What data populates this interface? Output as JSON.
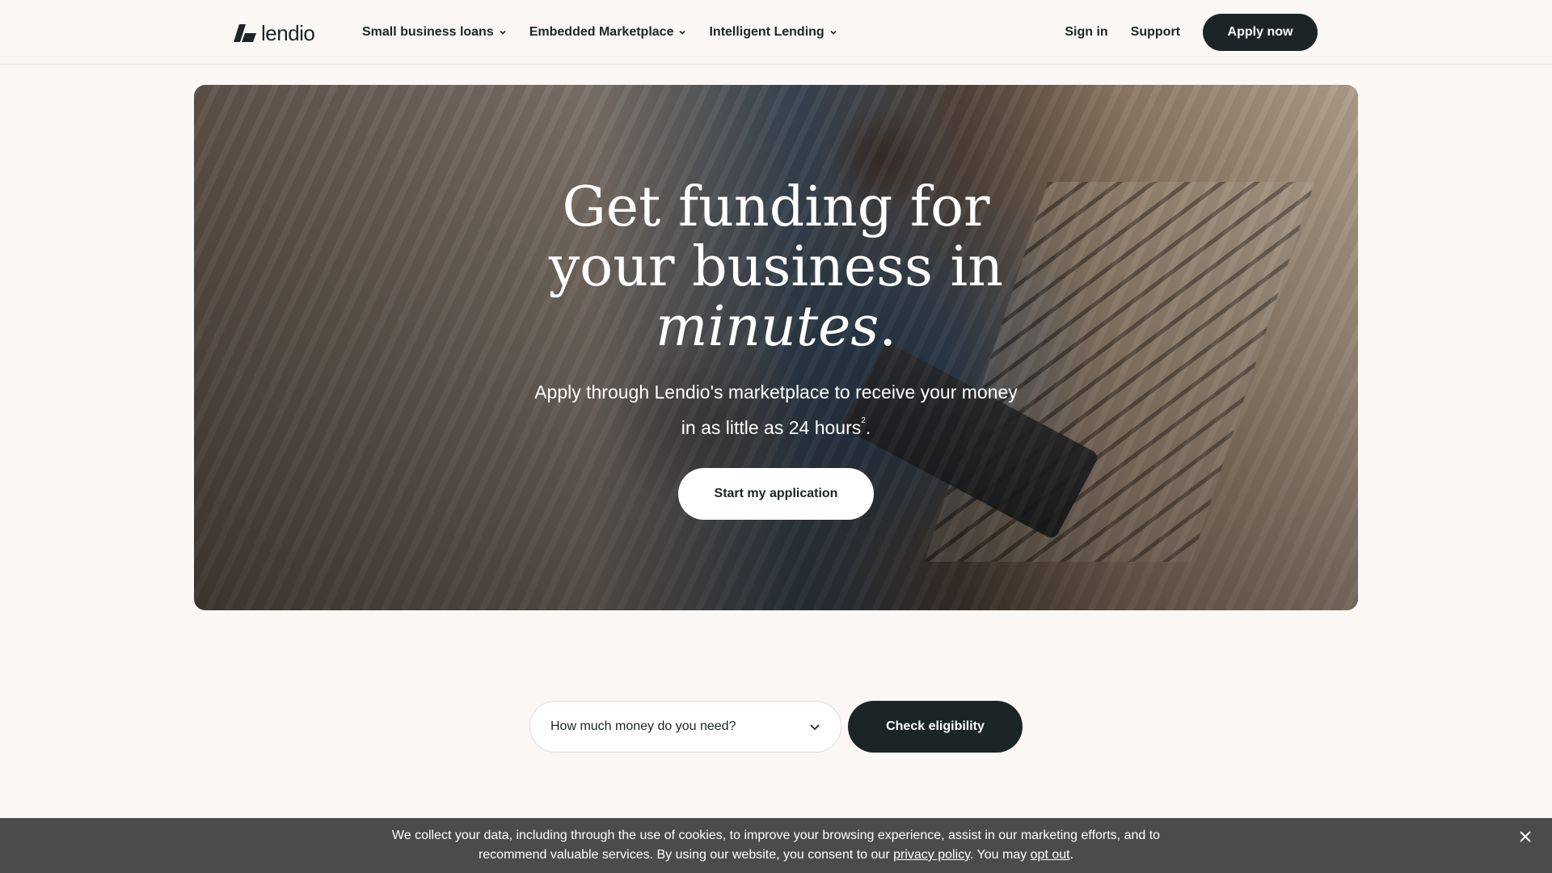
{
  "brand": {
    "name": "lendio"
  },
  "nav": {
    "menu": [
      {
        "label": "Small business loans"
      },
      {
        "label": "Embedded Marketplace"
      },
      {
        "label": "Intelligent Lending"
      }
    ],
    "sign_in": "Sign in",
    "support": "Support",
    "apply_now": "Apply now"
  },
  "hero": {
    "title_line1": "Get funding for",
    "title_line2": "your business in",
    "title_emphasis": "minutes",
    "title_end": ".",
    "subtitle_main": "Apply through Lendio's marketplace to receive your money in as little as 24 hours",
    "subtitle_footnote": "2",
    "subtitle_end": ".",
    "cta": "Start my application"
  },
  "eligibility": {
    "select_value": "How much money do you need?",
    "button": "Check eligibility"
  },
  "cookie_banner": {
    "text_before": "We collect your data, including through the use of cookies, to improve your browsing experience, assist in our marketing efforts, and to recommend valuable services. By using our website, you consent to our ",
    "privacy_link": "privacy policy",
    "text_middle": ". You may ",
    "opt_out_link": "opt out",
    "text_end": "."
  },
  "colors": {
    "primary_dark": "#1c2526",
    "page_background": "#faf7f5",
    "banner_background": "#4b4b4b"
  },
  "icons": [
    "lendio-logo-icon",
    "chevron-down-icon",
    "close-icon"
  ]
}
